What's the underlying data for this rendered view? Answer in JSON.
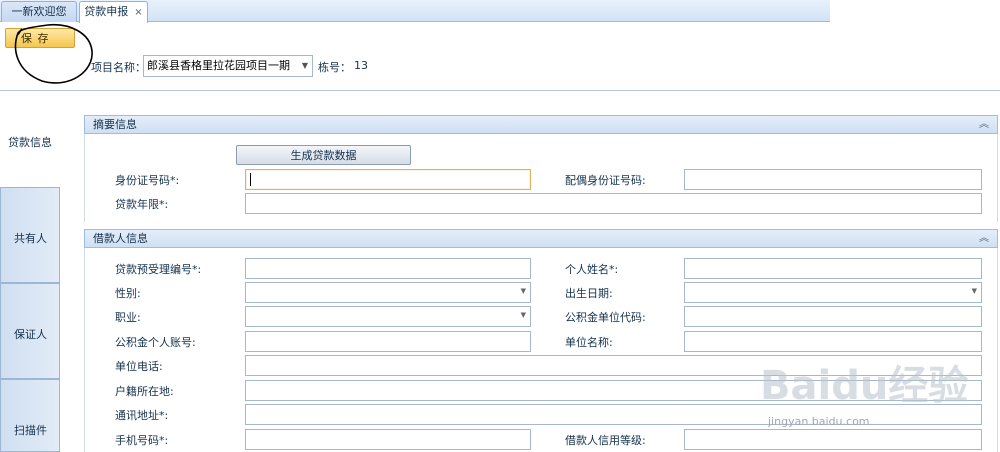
{
  "tabs": [
    {
      "label": "一新欢迎您"
    },
    {
      "label": "贷款申报",
      "close": "×"
    }
  ],
  "toolbar": {
    "save_label": "保  存"
  },
  "project": {
    "label": "项目名称：",
    "value": "郎溪县香格里拉花园项目一期",
    "building_label": "栋号：",
    "building_value": "13"
  },
  "side_tabs": [
    "贷款信息",
    "共有人",
    "保证人",
    "扫描件"
  ],
  "summary_panel": {
    "title": "摘要信息",
    "generate_button": "生成贷款数据",
    "fields": {
      "id_number": {
        "label": "身份证号码*:",
        "value": ""
      },
      "spouse_id": {
        "label": "配偶身份证号码:",
        "value": ""
      },
      "loan_term": {
        "label": "贷款年限*:",
        "value": ""
      }
    }
  },
  "borrower_panel": {
    "title": "借款人信息",
    "fields": {
      "pre_accept_no": {
        "label": "贷款预受理编号*:",
        "value": ""
      },
      "name": {
        "label": "个人姓名*:",
        "value": ""
      },
      "gender": {
        "label": "性别:",
        "value": ""
      },
      "birth_date": {
        "label": "出生日期:",
        "value": ""
      },
      "occupation": {
        "label": "职业:",
        "value": ""
      },
      "fund_unit_code": {
        "label": "公积金单位代码:",
        "value": ""
      },
      "fund_account": {
        "label": "公积金个人账号:",
        "value": ""
      },
      "unit_name": {
        "label": "单位名称:",
        "value": ""
      },
      "unit_phone": {
        "label": "单位电话:",
        "value": ""
      },
      "household": {
        "label": "户籍所在地:",
        "value": ""
      },
      "address": {
        "label": "通讯地址*:",
        "value": ""
      },
      "mobile": {
        "label": "手机号码*:",
        "value": ""
      },
      "credit_level": {
        "label": "借款人信用等级:",
        "value": ""
      }
    }
  },
  "watermark": {
    "brand": "Baidu经验",
    "url": "jingyan.baidu.com"
  },
  "icons": {
    "collapse": "chevron-double-up-icon",
    "dropdown": "chevron-down-icon",
    "close": "close-icon"
  },
  "colors": {
    "accent": "#99bbe8",
    "save_button": "#f6c64d",
    "panel_header": "#cfdff2"
  }
}
